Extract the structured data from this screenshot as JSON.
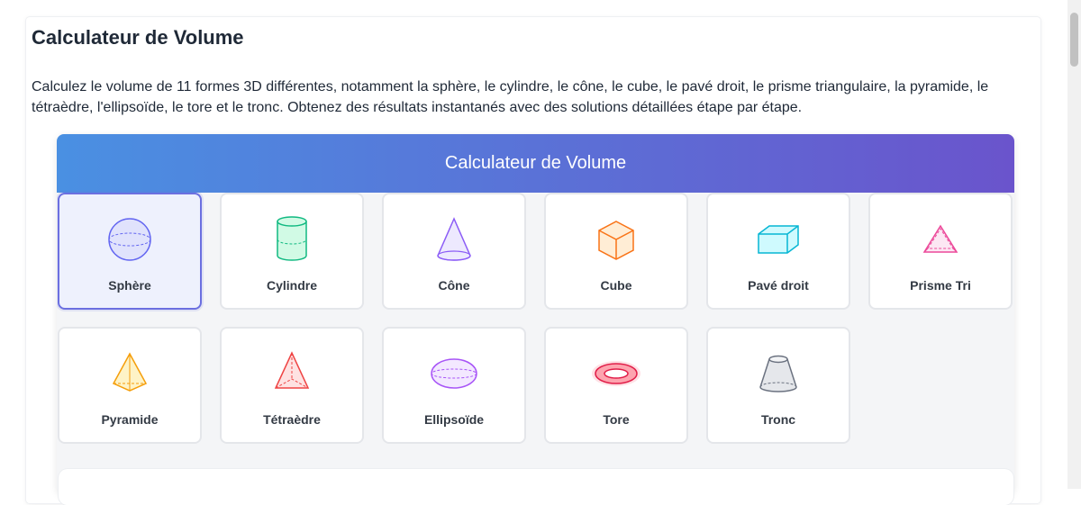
{
  "page": {
    "title": "Calculateur de Volume",
    "description": "Calculez le volume de 11 formes 3D différentes, notamment la sphère, le cylindre, le cône, le cube, le pavé droit, le prisme triangulaire, la pyramide, le tétraèdre, l'ellipsoïde, le tore et le tronc. Obtenez des résultats instantanés avec des solutions détaillées étape par étape."
  },
  "calculator": {
    "header": "Calculateur de Volume",
    "selected_shape": "Sphère",
    "shapes": [
      {
        "label": "Sphère",
        "icon": "sphere-icon",
        "color": "#6366f1"
      },
      {
        "label": "Cylindre",
        "icon": "cylinder-icon",
        "color": "#10b981"
      },
      {
        "label": "Cône",
        "icon": "cone-icon",
        "color": "#8b5cf6"
      },
      {
        "label": "Cube",
        "icon": "cube-icon",
        "color": "#f97316"
      },
      {
        "label": "Pavé droit",
        "icon": "cuboid-icon",
        "color": "#06b6d4"
      },
      {
        "label": "Prisme Tri",
        "icon": "triangular-prism-icon",
        "color": "#ec4899"
      },
      {
        "label": "Pyramide",
        "icon": "pyramid-icon",
        "color": "#f59e0b"
      },
      {
        "label": "Tétraèdre",
        "icon": "tetrahedron-icon",
        "color": "#ef4444"
      },
      {
        "label": "Ellipsoïde",
        "icon": "ellipsoid-icon",
        "color": "#a855f7"
      },
      {
        "label": "Tore",
        "icon": "torus-icon",
        "color": "#e11d48"
      },
      {
        "label": "Tronc",
        "icon": "frustum-icon",
        "color": "#6b7280"
      }
    ]
  },
  "colors": {
    "header_gradient_start": "#4a90e2",
    "header_gradient_end": "#6a54cc",
    "selected_border": "#6b6fe0",
    "selected_background": "#eef1fd"
  }
}
